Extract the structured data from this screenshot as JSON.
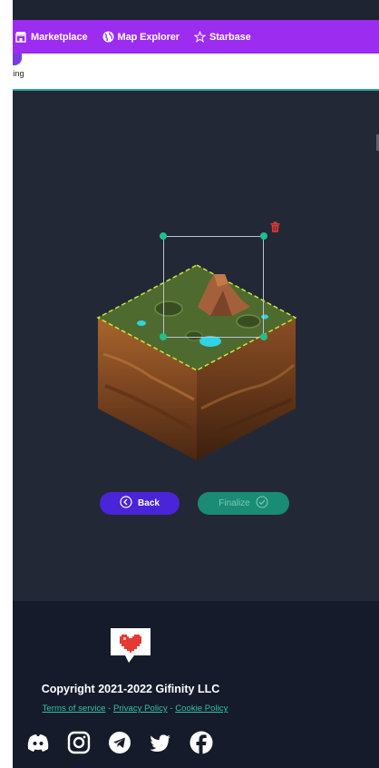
{
  "nav": {
    "items": [
      {
        "label": "Marketplace",
        "icon": "storefront-icon"
      },
      {
        "label": "Map Explorer",
        "icon": "globe-icon"
      },
      {
        "label": "Starbase",
        "icon": "star-outline-icon"
      }
    ]
  },
  "subnav": {
    "label": "king"
  },
  "editor": {
    "back_label": "Back",
    "finalize_label": "Finalize"
  },
  "footer": {
    "copyright": "Copyright 2021-2022 Gifinity LLC",
    "links": [
      {
        "label": "Terms of service"
      },
      {
        "label": "Privacy Policy"
      },
      {
        "label": "Cookie Policy"
      }
    ],
    "link_separator": " - ",
    "social": [
      "discord-icon",
      "instagram-icon",
      "telegram-icon",
      "twitter-icon",
      "facebook-icon"
    ]
  },
  "colors": {
    "nav_bg": "#9b2cf0",
    "canvas_bg": "#232836",
    "footer_bg": "#151b2b",
    "back_button": "#4a24d8",
    "finalize_button": "#1a8b74",
    "accent_teal": "#2ec4a0",
    "selection_handle": "#1fbf8f",
    "delete_red": "#e53935"
  }
}
